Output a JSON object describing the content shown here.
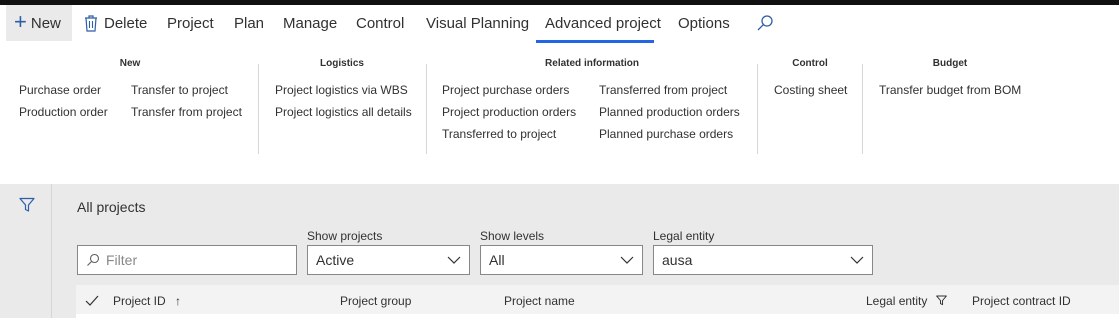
{
  "toolbar": {
    "new_label": "New",
    "delete_label": "Delete",
    "tabs": [
      "Project",
      "Plan",
      "Manage",
      "Control",
      "Visual Planning",
      "Advanced project",
      "Options"
    ],
    "active_tab": "Advanced project"
  },
  "ribbon": {
    "groups": [
      {
        "title": "New",
        "items": [
          "Purchase order",
          "Production order",
          "Transfer to project",
          "Transfer from project"
        ]
      },
      {
        "title": "Logistics",
        "items": [
          "Project logistics via WBS",
          "Project logistics all details"
        ]
      },
      {
        "title": "Related information",
        "items": [
          "Project purchase orders",
          "Project production orders",
          "Transferred to project",
          "Transferred from project",
          "Planned production orders",
          "Planned purchase orders"
        ]
      },
      {
        "title": "Control",
        "items": [
          "Costing sheet"
        ]
      },
      {
        "title": "Budget",
        "items": [
          "Transfer budget from BOM"
        ]
      }
    ]
  },
  "page": {
    "title": "All projects",
    "filter_placeholder": "Filter",
    "show_projects": {
      "label": "Show projects",
      "value": "Active"
    },
    "show_levels": {
      "label": "Show levels",
      "value": "All"
    },
    "legal_entity": {
      "label": "Legal entity",
      "value": "ausa"
    }
  },
  "grid": {
    "columns": [
      "Project ID",
      "Project group",
      "Project name",
      "Legal entity",
      "Project contract ID"
    ],
    "sort_indicator": "↑"
  },
  "colors": {
    "accent": "#2266e3",
    "icon_blue": "#2d5ea8"
  }
}
